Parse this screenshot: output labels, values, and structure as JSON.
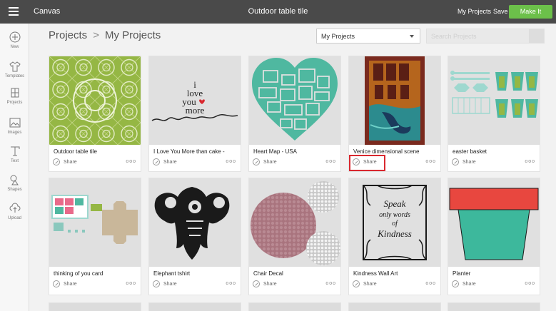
{
  "topbar": {
    "app_name": "Canvas",
    "doc_title": "Outdoor table tile",
    "my_projects": "My Projects",
    "save": "Save",
    "make_it": "Make It"
  },
  "sidebar": {
    "items": [
      {
        "label": "New",
        "icon": "plus-circle-icon"
      },
      {
        "label": "Templates",
        "icon": "tshirt-icon"
      },
      {
        "label": "Projects",
        "icon": "projects-icon"
      },
      {
        "label": "Images",
        "icon": "image-icon"
      },
      {
        "label": "Text",
        "icon": "text-icon"
      },
      {
        "label": "Shapes",
        "icon": "shapes-icon"
      },
      {
        "label": "Upload",
        "icon": "upload-icon"
      }
    ]
  },
  "header": {
    "breadcrumb": [
      "Projects",
      "My Projects"
    ],
    "filter_value": "My Projects",
    "search_placeholder": "Search Projects"
  },
  "share_label": "Share",
  "more_label": "ooo",
  "projects": [
    {
      "title": "Outdoor table tile"
    },
    {
      "title": "I Love You More than cake -"
    },
    {
      "title": "Heart Map - USA"
    },
    {
      "title": "Venice dimensional scene"
    },
    {
      "title": "easter basket"
    },
    {
      "title": "thinking of you card"
    },
    {
      "title": "Elephant tshirt"
    },
    {
      "title": "Chair Decal"
    },
    {
      "title": "Kindness Wall Art"
    },
    {
      "title": "Planter"
    }
  ],
  "thumb_text": {
    "love": [
      "i",
      "love",
      "you",
      "more"
    ],
    "kindness": [
      "Speak",
      "only words",
      "of",
      "Kindness"
    ]
  },
  "colors": {
    "topbar": "#4a4a4a",
    "make_it": "#6cc04a",
    "highlight": "#d9282f",
    "teal": "#4fb8a0",
    "tile_green": "#95b744",
    "planter_red": "#e8473f",
    "planter_teal": "#3db89c"
  }
}
